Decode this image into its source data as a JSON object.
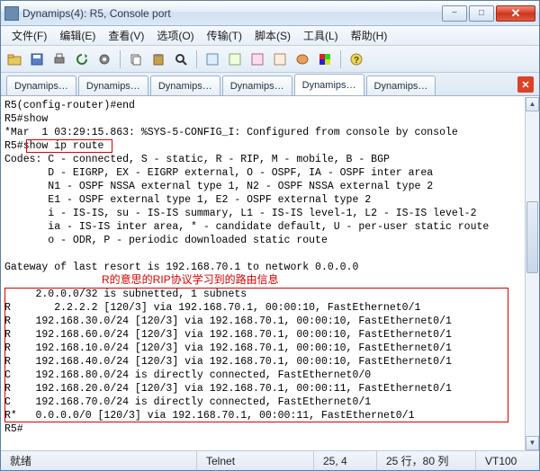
{
  "window": {
    "title": "Dynamips(4): R5, Console port"
  },
  "menu": {
    "file": "文件(F)",
    "edit": "编辑(E)",
    "view": "查看(V)",
    "options": "选项(O)",
    "transfer": "传输(T)",
    "script": "脚本(S)",
    "tools": "工具(L)",
    "help": "帮助(H)"
  },
  "toolbar_icons": [
    "folder-icon",
    "save-icon",
    "printer-icon",
    "refresh-icon",
    "settings-icon",
    "sep",
    "copy-icon",
    "paste-icon",
    "search-icon",
    "sep",
    "prop1-icon",
    "prop2-icon",
    "prop3-icon",
    "prop4-icon",
    "palette-icon",
    "colors-icon",
    "sep",
    "help-icon"
  ],
  "tabs": {
    "items": [
      {
        "label": "Dynamips…"
      },
      {
        "label": "Dynamips…"
      },
      {
        "label": "Dynamips…"
      },
      {
        "label": "Dynamips…"
      },
      {
        "label": "Dynamips…"
      },
      {
        "label": "Dynamips…"
      }
    ],
    "active_index": 4
  },
  "terminal": {
    "lines": [
      "R5(config-router)#end",
      "R5#show",
      "*Mar  1 03:29:15.863: %SYS-5-CONFIG_I: Configured from console by console",
      "R5#show ip route",
      "Codes: C - connected, S - static, R - RIP, M - mobile, B - BGP",
      "       D - EIGRP, EX - EIGRP external, O - OSPF, IA - OSPF inter area",
      "       N1 - OSPF NSSA external type 1, N2 - OSPF NSSA external type 2",
      "       E1 - OSPF external type 1, E2 - OSPF external type 2",
      "       i - IS-IS, su - IS-IS summary, L1 - IS-IS level-1, L2 - IS-IS level-2",
      "       ia - IS-IS inter area, * - candidate default, U - per-user static route",
      "       o - ODR, P - periodic downloaded static route",
      "",
      "Gateway of last resort is 192.168.70.1 to network 0.0.0.0",
      "",
      "     2.0.0.0/32 is subnetted, 1 subnets",
      "R       2.2.2.2 [120/3] via 192.168.70.1, 00:00:10, FastEthernet0/1",
      "R    192.168.30.0/24 [120/3] via 192.168.70.1, 00:00:10, FastEthernet0/1",
      "R    192.168.60.0/24 [120/3] via 192.168.70.1, 00:00:10, FastEthernet0/1",
      "R    192.168.10.0/24 [120/3] via 192.168.70.1, 00:00:10, FastEthernet0/1",
      "R    192.168.40.0/24 [120/3] via 192.168.70.1, 00:00:10, FastEthernet0/1",
      "C    192.168.80.0/24 is directly connected, FastEthernet0/0",
      "R    192.168.20.0/24 [120/3] via 192.168.70.1, 00:00:11, FastEthernet0/1",
      "C    192.168.70.0/24 is directly connected, FastEthernet0/1",
      "R*   0.0.0.0/0 [120/3] via 192.168.70.1, 00:00:11, FastEthernet0/1",
      "R5#"
    ],
    "highlight_cmd": "show ip route",
    "annotation": "R的意思的RIP协议学习到的路由信息"
  },
  "status": {
    "ready": "就绪",
    "protocol": "Telnet",
    "cursor": "25,  4",
    "size": "25 行，80 列",
    "term": "VT100"
  }
}
